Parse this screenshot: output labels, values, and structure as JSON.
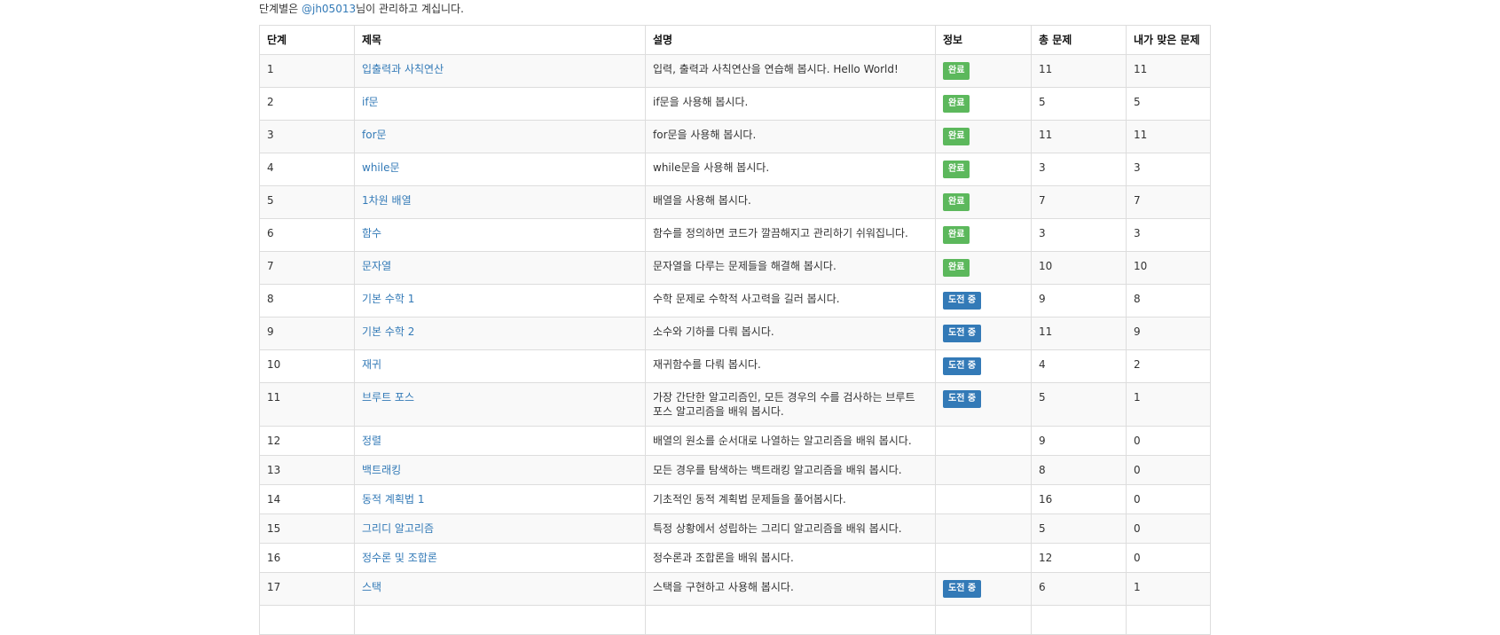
{
  "header": {
    "prefix": "단계별은 ",
    "maintainer": "@jh05013",
    "suffix": "님이 관리하고 계십니다."
  },
  "table": {
    "columns": {
      "step": "단계",
      "title": "제목",
      "description": "설명",
      "info": "정보",
      "total": "총 문제",
      "solved": "내가 맞은 문제"
    },
    "rows": [
      {
        "step": "1",
        "title": "입출력과 사칙연산",
        "description": "입력, 출력과 사칙연산을 연습해 봅시다. Hello World!",
        "status": "완료",
        "status_type": "done",
        "total": "11",
        "solved": "11"
      },
      {
        "step": "2",
        "title": "if문",
        "description": "if문을 사용해 봅시다.",
        "status": "완료",
        "status_type": "done",
        "total": "5",
        "solved": "5"
      },
      {
        "step": "3",
        "title": "for문",
        "description": "for문을 사용해 봅시다.",
        "status": "완료",
        "status_type": "done",
        "total": "11",
        "solved": "11"
      },
      {
        "step": "4",
        "title": "while문",
        "description": "while문을 사용해 봅시다.",
        "status": "완료",
        "status_type": "done",
        "total": "3",
        "solved": "3"
      },
      {
        "step": "5",
        "title": "1차원 배열",
        "description": "배열을 사용해 봅시다.",
        "status": "완료",
        "status_type": "done",
        "total": "7",
        "solved": "7"
      },
      {
        "step": "6",
        "title": "함수",
        "description": "함수를 정의하면 코드가 깔끔해지고 관리하기 쉬워집니다.",
        "status": "완료",
        "status_type": "done",
        "total": "3",
        "solved": "3"
      },
      {
        "step": "7",
        "title": "문자열",
        "description": "문자열을 다루는 문제들을 해결해 봅시다.",
        "status": "완료",
        "status_type": "done",
        "total": "10",
        "solved": "10"
      },
      {
        "step": "8",
        "title": "기본 수학 1",
        "description": "수학 문제로 수학적 사고력을 길러 봅시다.",
        "status": "도전 중",
        "status_type": "trying",
        "total": "9",
        "solved": "8"
      },
      {
        "step": "9",
        "title": "기본 수학 2",
        "description": "소수와 기하를 다뤄 봅시다.",
        "status": "도전 중",
        "status_type": "trying",
        "total": "11",
        "solved": "9"
      },
      {
        "step": "10",
        "title": "재귀",
        "description": "재귀함수를 다뤄 봅시다.",
        "status": "도전 중",
        "status_type": "trying",
        "total": "4",
        "solved": "2"
      },
      {
        "step": "11",
        "title": "브루트 포스",
        "description": "가장 간단한 알고리즘인, 모든 경우의 수를 검사하는 브루트 포스 알고리즘을 배워 봅시다.",
        "status": "도전 중",
        "status_type": "trying",
        "total": "5",
        "solved": "1"
      },
      {
        "step": "12",
        "title": "정렬",
        "description": "배열의 원소를 순서대로 나열하는 알고리즘을 배워 봅시다.",
        "status": "",
        "status_type": "",
        "total": "9",
        "solved": "0"
      },
      {
        "step": "13",
        "title": "백트래킹",
        "description": "모든 경우를 탐색하는 백트래킹 알고리즘을 배워 봅시다.",
        "status": "",
        "status_type": "",
        "total": "8",
        "solved": "0"
      },
      {
        "step": "14",
        "title": "동적 계획법 1",
        "description": "기초적인 동적 계획법 문제들을 풀어봅시다.",
        "status": "",
        "status_type": "",
        "total": "16",
        "solved": "0"
      },
      {
        "step": "15",
        "title": "그리디 알고리즘",
        "description": "특정 상황에서 성립하는 그리디 알고리즘을 배워 봅시다.",
        "status": "",
        "status_type": "",
        "total": "5",
        "solved": "0"
      },
      {
        "step": "16",
        "title": "정수론 및 조합론",
        "description": "정수론과 조합론을 배워 봅시다.",
        "status": "",
        "status_type": "",
        "total": "12",
        "solved": "0"
      },
      {
        "step": "17",
        "title": "스택",
        "description": "스택을 구현하고 사용해 봅시다.",
        "status": "도전 중",
        "status_type": "trying",
        "total": "6",
        "solved": "1"
      }
    ]
  },
  "colors": {
    "link": "#337ab7",
    "badge_done": "#5cb85c",
    "badge_trying": "#337ab7"
  }
}
